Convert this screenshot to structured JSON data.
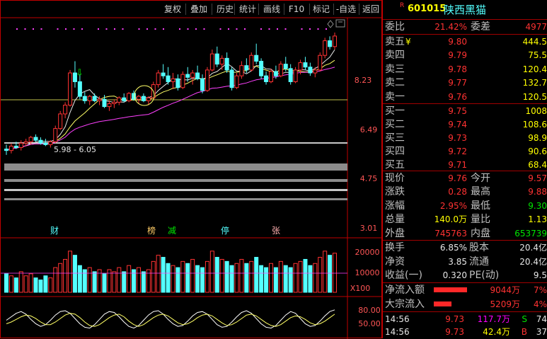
{
  "toolbar": {
    "buttons": [
      "复权",
      "叠加",
      "历史",
      "统计",
      "画线",
      "F10",
      "标记",
      "-自选",
      "返回"
    ]
  },
  "colors": {
    "up": "#ff3232",
    "down": "#54ffff",
    "frame": "#c00000",
    "ma_white": "#e6e6e6",
    "ma_yellow": "#ffff66",
    "ma_magenta": "#ff40ff"
  },
  "quote": {
    "badge": "R",
    "code": "601015",
    "name": "陕西黑猫",
    "wei_bi_label": "委比",
    "wei_bi_value": "21.42%",
    "wei_cha_label": "委差",
    "wei_cha_value": "4977",
    "sell": [
      {
        "label": "卖五",
        "flag": "¥",
        "price": "9.80",
        "vol": "444.5"
      },
      {
        "label": "卖四",
        "flag": "",
        "price": "9.79",
        "vol": "75.5"
      },
      {
        "label": "卖三",
        "flag": "",
        "price": "9.78",
        "vol": "120.4"
      },
      {
        "label": "卖二",
        "flag": "",
        "price": "9.77",
        "vol": "132.7"
      },
      {
        "label": "卖一",
        "flag": "",
        "price": "9.76",
        "vol": "120.5"
      }
    ],
    "buy": [
      {
        "label": "买一",
        "price": "9.75",
        "vol": "1008"
      },
      {
        "label": "买二",
        "price": "9.74",
        "vol": "108.6"
      },
      {
        "label": "买三",
        "price": "9.73",
        "vol": "98.9"
      },
      {
        "label": "买四",
        "price": "9.72",
        "vol": "90.6"
      },
      {
        "label": "买五",
        "price": "9.71",
        "vol": "68.4"
      }
    ],
    "stats": [
      {
        "l1": "现价",
        "v1": "9.76",
        "c1": "red",
        "l2": "今开",
        "v2": "9.57",
        "c2": "red"
      },
      {
        "l1": "涨跌",
        "v1": "0.28",
        "c1": "red",
        "l2": "最高",
        "v2": "9.88",
        "c2": "red"
      },
      {
        "l1": "涨幅",
        "v1": "2.95%",
        "c1": "red",
        "l2": "最低",
        "v2": "9.30",
        "c2": "green"
      },
      {
        "l1": "总量",
        "v1": "140.0万",
        "c1": "yellow",
        "l2": "量比",
        "v2": "1.13",
        "c2": "yellow"
      },
      {
        "l1": "外盘",
        "v1": "745763",
        "c1": "red",
        "l2": "内盘",
        "v2": "653739",
        "c2": "green"
      }
    ],
    "finance": [
      {
        "l1": "换手",
        "v1": "6.85%",
        "l2": "股本",
        "v2": "20.4亿"
      },
      {
        "l1": "净资",
        "v1": "3.85",
        "l2": "流通",
        "v2": "20.4亿"
      },
      {
        "l1": "收益(一)",
        "v1": "0.320",
        "l2": "PE(动)",
        "v2": "9.5"
      }
    ],
    "flows": [
      {
        "label": "净流入额",
        "value": "9044万",
        "pct": "7%",
        "bar": 0.85
      },
      {
        "label": "大宗流入",
        "value": "5209万",
        "pct": "4%",
        "bar": 0.45
      }
    ],
    "ticks": [
      {
        "time": "14:56",
        "price": "9.73",
        "vol": "117.7万",
        "side": "S",
        "extra": "74"
      },
      {
        "time": "14:56",
        "price": "9.73",
        "vol": "42.4万",
        "side": "B",
        "extra": "37"
      }
    ]
  },
  "chart_data": {
    "type": "candlestick",
    "price_axis_ticks": [
      "8.23",
      "6.49",
      "4.75",
      "3.01"
    ],
    "range_label": "5.98 - 6.05",
    "event_markers": [
      {
        "text": "财",
        "color": "#54ffff"
      },
      {
        "text": "榜",
        "color": "#ffcc66"
      },
      {
        "text": "减",
        "color": "#00e600"
      },
      {
        "text": "停",
        "color": "#54ffff"
      },
      {
        "text": "张",
        "color": "#ffb0b0"
      }
    ],
    "volume_axis_ticks": [
      "20000",
      "10000"
    ],
    "volume_unit": "X100",
    "indicator_axis_ticks": [
      "80.00",
      "50.00"
    ],
    "ylim": [
      3.01,
      9.97
    ],
    "candles": [
      [
        5.9,
        6.05,
        5.7,
        5.85
      ],
      [
        5.85,
        6.1,
        5.75,
        6.0
      ],
      [
        6.0,
        6.15,
        5.9,
        5.95
      ],
      [
        5.95,
        6.2,
        5.85,
        6.1
      ],
      [
        6.1,
        6.25,
        6.0,
        6.15
      ],
      [
        6.15,
        6.35,
        6.05,
        6.3
      ],
      [
        6.3,
        6.4,
        6.15,
        6.2
      ],
      [
        6.2,
        6.3,
        6.05,
        6.1
      ],
      [
        6.1,
        6.25,
        6.0,
        6.05
      ],
      [
        6.05,
        6.2,
        5.95,
        6.15
      ],
      [
        6.15,
        6.7,
        6.1,
        6.6
      ],
      [
        6.6,
        7.2,
        6.55,
        7.1
      ],
      [
        7.1,
        7.5,
        6.95,
        7.4
      ],
      [
        7.4,
        8.6,
        7.35,
        8.5
      ],
      [
        8.5,
        8.9,
        8.0,
        8.2
      ],
      [
        8.2,
        8.45,
        7.6,
        7.7
      ],
      [
        7.7,
        7.85,
        7.45,
        7.55
      ],
      [
        7.55,
        7.75,
        7.4,
        7.7
      ],
      [
        7.7,
        7.8,
        7.5,
        7.55
      ],
      [
        7.55,
        7.7,
        7.4,
        7.6
      ],
      [
        7.6,
        7.75,
        7.3,
        7.35
      ],
      [
        7.35,
        7.55,
        7.2,
        7.45
      ],
      [
        7.45,
        7.6,
        7.3,
        7.5
      ],
      [
        7.5,
        7.7,
        7.4,
        7.65
      ],
      [
        7.65,
        7.8,
        7.5,
        7.55
      ],
      [
        7.55,
        7.85,
        7.5,
        7.8
      ],
      [
        7.8,
        7.9,
        7.55,
        7.6
      ],
      [
        7.6,
        7.75,
        7.45,
        7.7
      ],
      [
        7.7,
        7.8,
        7.5,
        7.55
      ],
      [
        7.55,
        7.7,
        7.4,
        7.65
      ],
      [
        7.65,
        8.2,
        7.6,
        8.1
      ],
      [
        8.1,
        8.6,
        8.0,
        8.5
      ],
      [
        8.5,
        8.8,
        8.3,
        8.4
      ],
      [
        8.4,
        8.7,
        8.1,
        8.2
      ],
      [
        8.2,
        8.5,
        7.95,
        8.3
      ],
      [
        8.3,
        8.45,
        7.9,
        8.0
      ],
      [
        8.0,
        8.55,
        7.95,
        8.45
      ],
      [
        8.45,
        8.7,
        8.2,
        8.35
      ],
      [
        8.35,
        8.6,
        8.1,
        8.5
      ],
      [
        8.5,
        8.75,
        8.25,
        8.3
      ],
      [
        8.3,
        8.45,
        7.8,
        7.9
      ],
      [
        7.9,
        8.7,
        7.85,
        8.6
      ],
      [
        8.6,
        9.3,
        8.55,
        9.15
      ],
      [
        9.15,
        9.4,
        8.7,
        8.8
      ],
      [
        8.8,
        9.1,
        8.6,
        9.0
      ],
      [
        9.0,
        9.2,
        8.5,
        8.6
      ],
      [
        8.6,
        8.7,
        7.9,
        8.0
      ],
      [
        8.0,
        8.5,
        7.95,
        8.4
      ],
      [
        8.4,
        8.9,
        8.3,
        8.75
      ],
      [
        8.75,
        9.0,
        8.5,
        8.6
      ],
      [
        8.6,
        9.2,
        8.55,
        9.1
      ],
      [
        9.1,
        9.5,
        8.8,
        8.9
      ],
      [
        8.9,
        9.0,
        8.3,
        8.4
      ],
      [
        8.4,
        8.55,
        8.1,
        8.2
      ],
      [
        8.2,
        8.65,
        8.15,
        8.55
      ],
      [
        8.55,
        8.75,
        8.3,
        8.4
      ],
      [
        8.4,
        8.9,
        8.35,
        8.8
      ],
      [
        8.8,
        9.05,
        8.55,
        8.65
      ],
      [
        8.65,
        8.8,
        8.1,
        8.2
      ],
      [
        8.2,
        8.7,
        8.15,
        8.6
      ],
      [
        8.6,
        8.95,
        8.45,
        8.85
      ],
      [
        8.85,
        9.05,
        8.6,
        8.7
      ],
      [
        8.7,
        8.85,
        8.4,
        8.5
      ],
      [
        8.5,
        8.7,
        8.35,
        8.6
      ],
      [
        8.6,
        9.2,
        8.55,
        9.1
      ],
      [
        9.1,
        9.7,
        9.0,
        9.6
      ],
      [
        9.6,
        9.75,
        9.3,
        9.4
      ],
      [
        9.4,
        9.88,
        9.3,
        9.76
      ]
    ],
    "volumes": [
      90,
      80,
      70,
      100,
      80,
      90,
      70,
      60,
      80,
      70,
      120,
      140,
      160,
      200,
      180,
      130,
      110,
      120,
      100,
      110,
      90,
      110,
      100,
      120,
      100,
      130,
      110,
      120,
      100,
      110,
      150,
      180,
      170,
      140,
      130,
      120,
      150,
      140,
      160,
      130,
      120,
      150,
      200,
      170,
      160,
      150,
      130,
      140,
      160,
      140,
      150,
      170,
      130,
      120,
      140,
      120,
      150,
      130,
      120,
      140,
      150,
      160,
      130,
      140,
      170,
      200,
      180,
      190
    ],
    "indicator_lines": [
      [
        60,
        68,
        76,
        80,
        74,
        62,
        52,
        46,
        50,
        60,
        72,
        80,
        82,
        76,
        64,
        52,
        44,
        42,
        50,
        62,
        74,
        80,
        78,
        68,
        56,
        46,
        42,
        48,
        60,
        72,
        80,
        82,
        74,
        62,
        52,
        46,
        48,
        58,
        70,
        78,
        80,
        74,
        62,
        50,
        44,
        46,
        56,
        68,
        78,
        82,
        76,
        64,
        52,
        44,
        42,
        48,
        60,
        72,
        80,
        76,
        64,
        52,
        46,
        48,
        58,
        70,
        80,
        84
      ],
      [
        52,
        56,
        62,
        68,
        72,
        70,
        64,
        56,
        50,
        50,
        56,
        64,
        72,
        76,
        74,
        66,
        56,
        48,
        46,
        50,
        58,
        66,
        72,
        74,
        68,
        58,
        50,
        46,
        50,
        58,
        66,
        72,
        74,
        70,
        62,
        54,
        50,
        52,
        58,
        66,
        72,
        74,
        70,
        62,
        54,
        48,
        50,
        56,
        64,
        72,
        74,
        70,
        62,
        54,
        48,
        46,
        50,
        58,
        66,
        70,
        68,
        62,
        54,
        50,
        52,
        58,
        66,
        74
      ]
    ]
  }
}
